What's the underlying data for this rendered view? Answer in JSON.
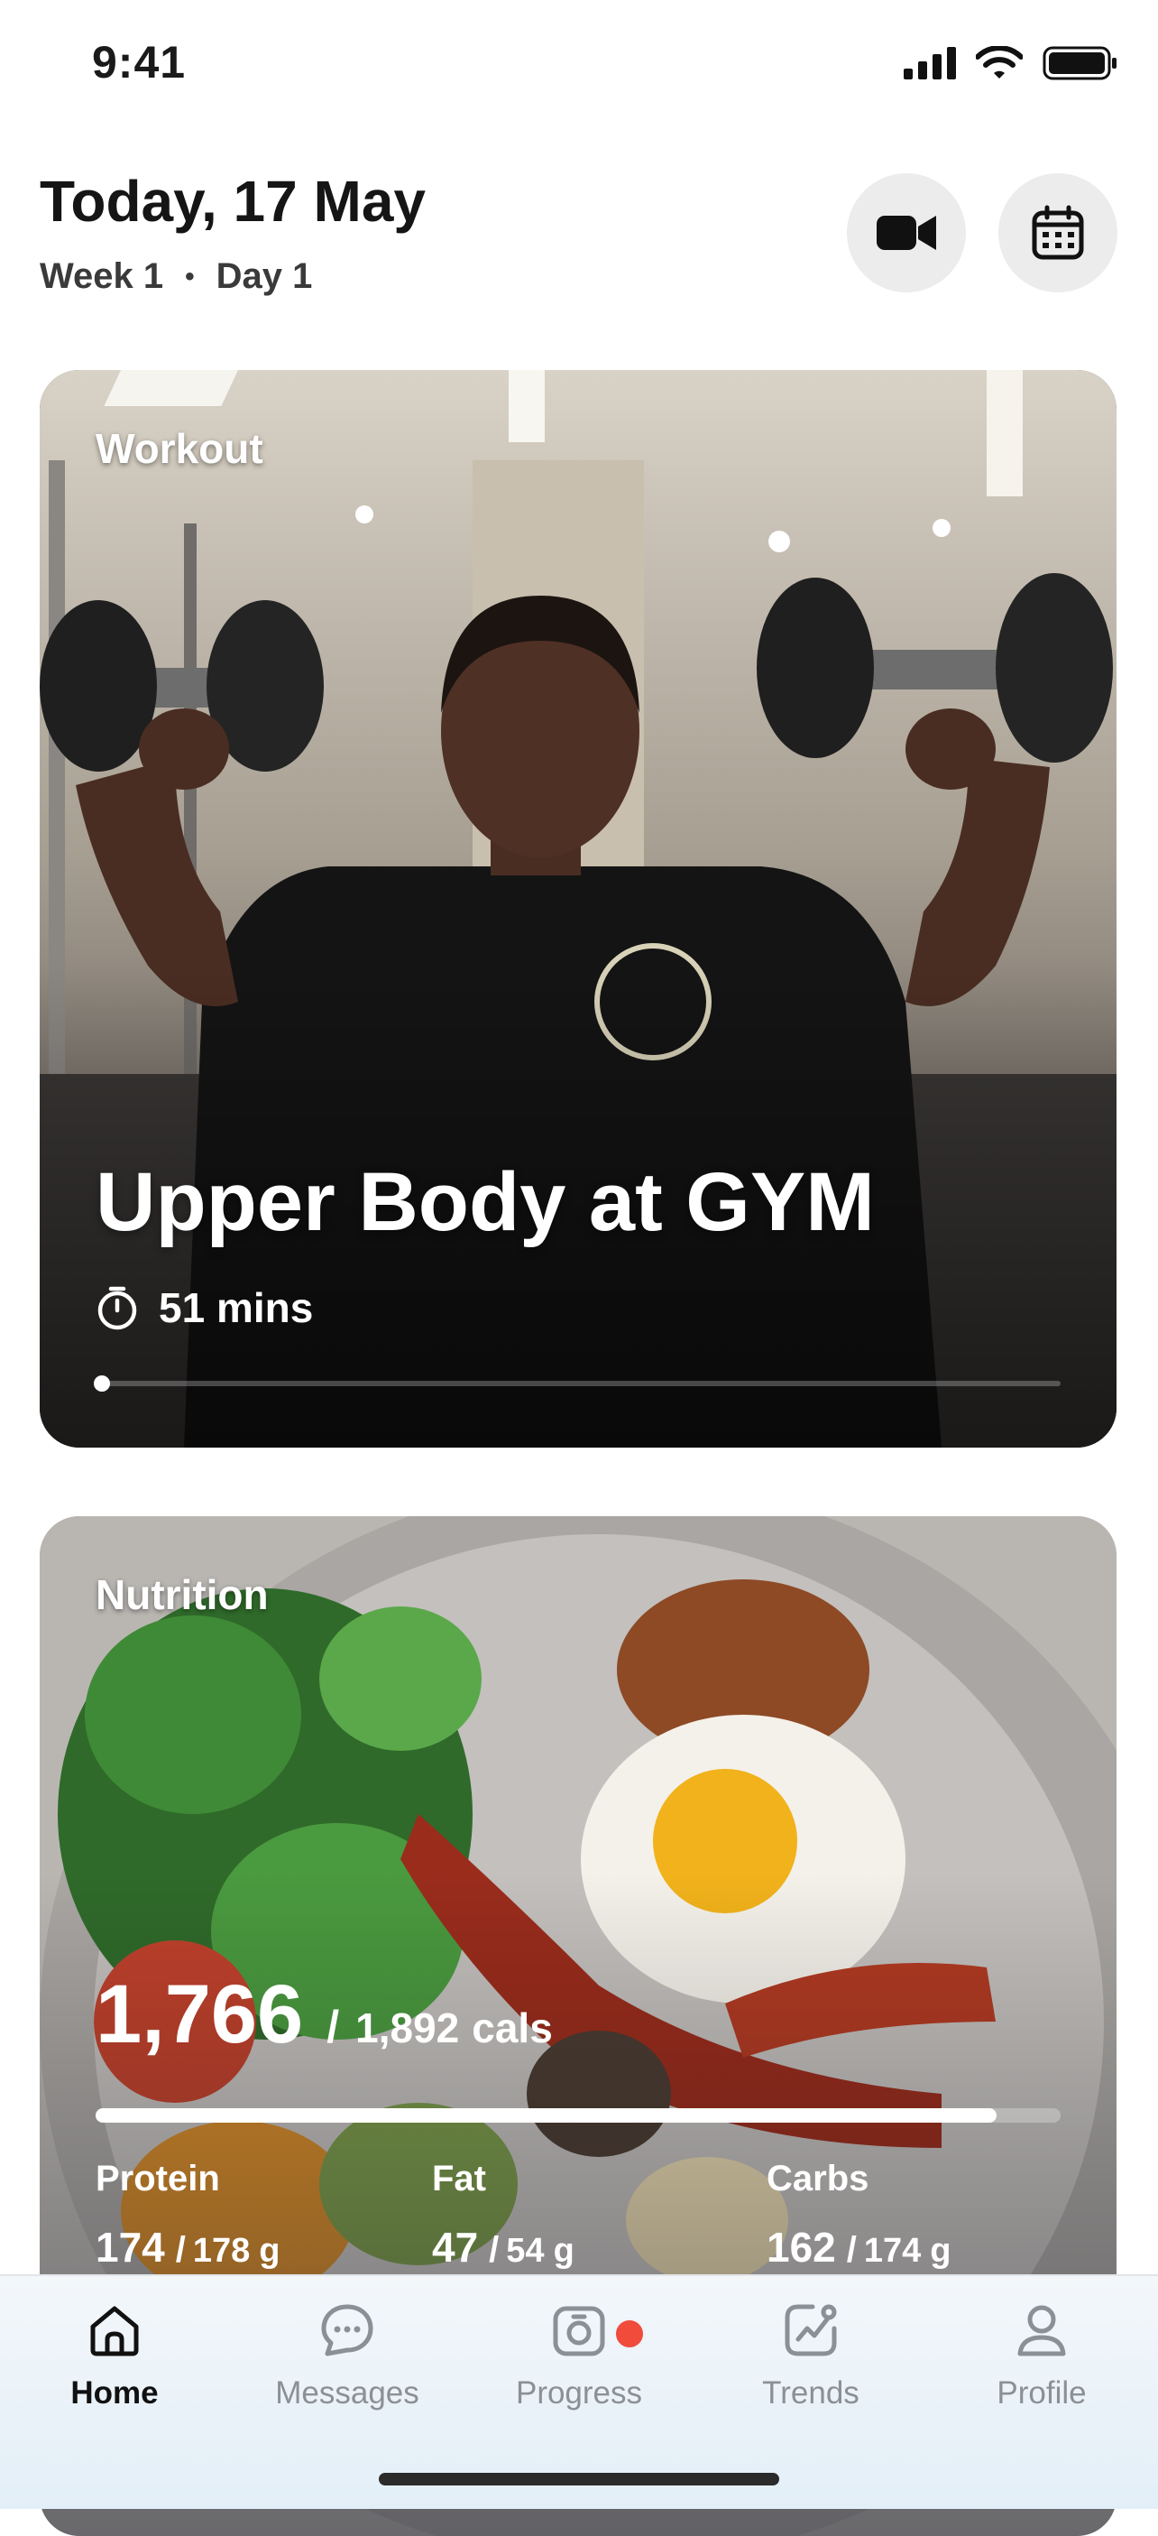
{
  "status_bar": {
    "time": "9:41"
  },
  "header": {
    "title": "Today, 17 May",
    "week": "Week 1",
    "separator": "•",
    "day": "Day 1"
  },
  "icons": {
    "video": "video-camera-icon",
    "calendar": "calendar-icon",
    "timer": "stopwatch-icon"
  },
  "workout": {
    "label": "Workout",
    "title": "Upper Body at GYM",
    "duration": "51 mins",
    "progress": 0.0
  },
  "nutrition": {
    "label": "Nutrition",
    "calories": "1,766",
    "separator": "/",
    "calories_goal": "1,892",
    "calories_unit": "cals",
    "calories_progress": 0.9334,
    "macros": [
      {
        "label": "Protein",
        "value": "174",
        "goal": "178",
        "unit": "g"
      },
      {
        "label": "Fat",
        "value": "47",
        "goal": "54",
        "unit": "g"
      },
      {
        "label": "Carbs",
        "value": "162",
        "goal": "174",
        "unit": "g"
      }
    ]
  },
  "tab_bar": {
    "tabs": [
      {
        "label": "Home",
        "icon": "home-icon",
        "active": true
      },
      {
        "label": "Messages",
        "icon": "chat-bubble-icon",
        "active": false
      },
      {
        "label": "Progress",
        "icon": "camera-icon",
        "active": false,
        "badge": true
      },
      {
        "label": "Trends",
        "icon": "trend-chart-icon",
        "active": false
      },
      {
        "label": "Profile",
        "icon": "person-icon",
        "active": false
      }
    ]
  },
  "colors": {
    "badge": "#f04b3b",
    "active_tab": "#111111",
    "inactive_tab": "#8b9096",
    "button_bg": "#ececec"
  }
}
